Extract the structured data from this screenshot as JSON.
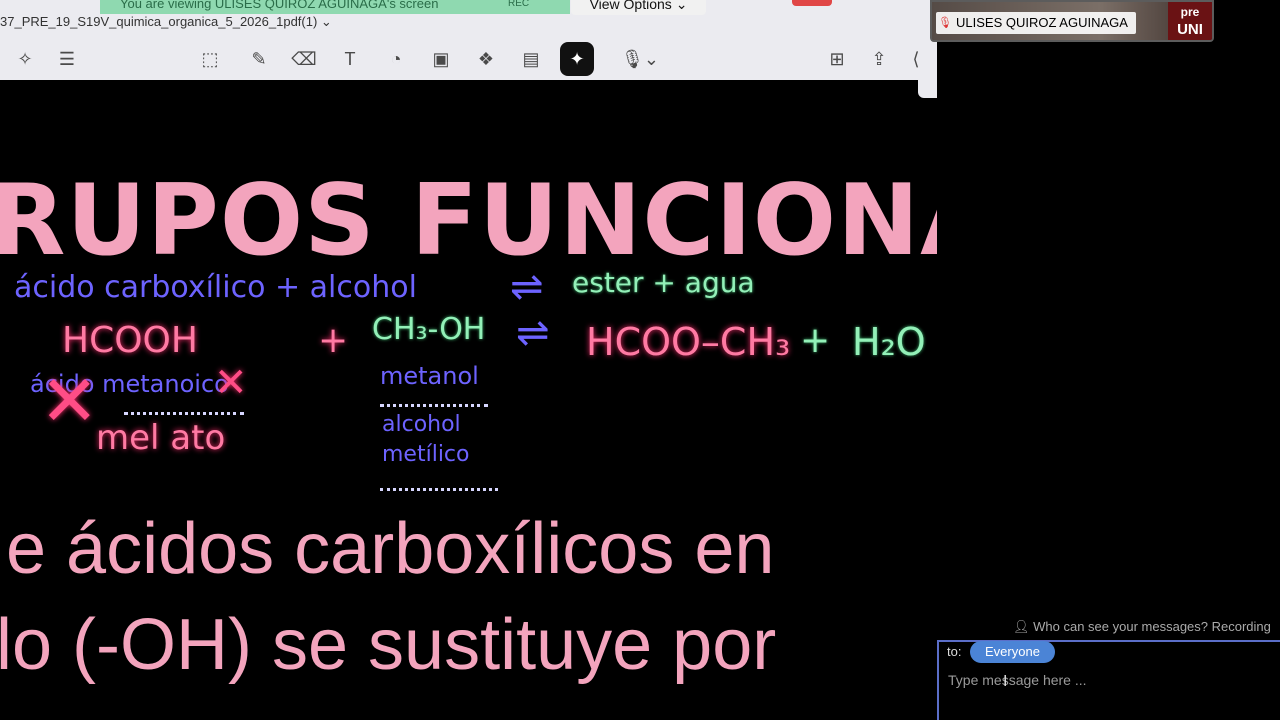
{
  "zoom_bar": {
    "banner_text": "You are viewing ULISES QUIROZ AGUINAGA's screen",
    "rec_label": "REC",
    "view_options_label": "View Options",
    "view_options_chevron": "⌄"
  },
  "pdf_app": {
    "doc_title": "37_PRE_19_S19V_quimica_organica_5_2026_1pdf(1)",
    "doc_title_chevron": "⌄",
    "toolbar_icons": [
      "select-icon",
      "notes-icon",
      "lasso-icon",
      "pen-icon",
      "eraser-icon",
      "textbox-icon",
      "shapes-icon",
      "image-icon",
      "elements-icon",
      "sticky-note-icon",
      "laser-pointer-icon",
      "voice-icon",
      "new-page-icon",
      "share-icon"
    ]
  },
  "whiteboard": {
    "heading": "RUPOS FUNCIONAL",
    "line1": {
      "left": "ácido carboxílico + alcohol",
      "arrow": "⇌",
      "right": "ester + agua"
    },
    "line2": {
      "acid": "HCOOH",
      "plus": "+",
      "alcohol": "CH₃-OH",
      "arrow": "⇌",
      "product": "HCOO–CH₃",
      "plus2": "+",
      "water": "H₂O"
    },
    "notes": {
      "acid_name": "ácido metanoico",
      "acid_name2": "mel ato",
      "alc_name": "metanol",
      "alc_name2": "alcohol metílico"
    }
  },
  "slide": {
    "line1": "e ácidos carboxílicos en",
    "line2": "lo (-OH) se sustituye por"
  },
  "participant": {
    "name": "ULISES QUIROZ AGUINAGA",
    "logo_text": "pre\nUNI"
  },
  "chat": {
    "who_sees": "Who can see your messages? Recording",
    "to_label": "to:",
    "recipient": "Everyone",
    "placeholder": "Type message here ..."
  }
}
